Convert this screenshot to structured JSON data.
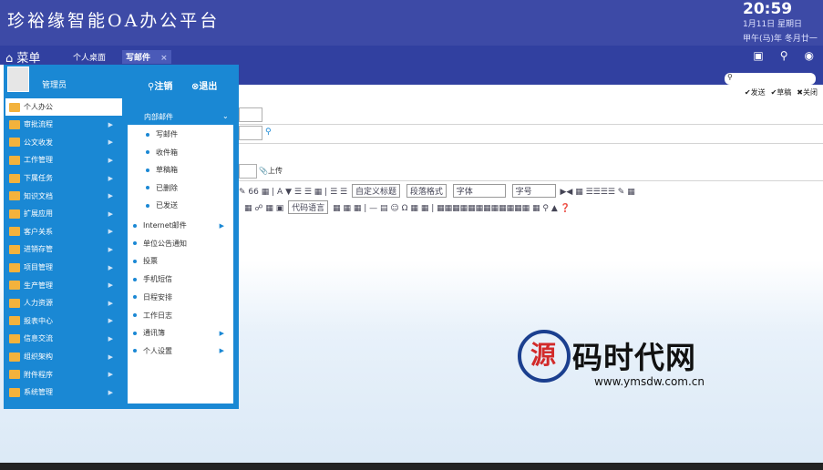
{
  "header": {
    "title": "珍裕缘智能OA办公平台",
    "time": "20:59",
    "date": "1月11日 星期日",
    "lunar": "甲午(马)年 冬月廿一"
  },
  "tabs": {
    "menu": "菜单",
    "home": "个人桌面",
    "compose": "写邮件",
    "close": "×"
  },
  "actions": {
    "send": "发送",
    "draft": "草稿",
    "close": "关闭"
  },
  "user": {
    "name": "管理员",
    "logout": "注销",
    "exit": "退出"
  },
  "nav": [
    {
      "label": "个人办公",
      "active": true
    },
    {
      "label": "审批流程"
    },
    {
      "label": "公文收发"
    },
    {
      "label": "工作管理"
    },
    {
      "label": "下属任务"
    },
    {
      "label": "知识文档"
    },
    {
      "label": "扩展应用"
    },
    {
      "label": "客户关系"
    },
    {
      "label": "进销存管"
    },
    {
      "label": "项目管理"
    },
    {
      "label": "生产管理"
    },
    {
      "label": "人力资源"
    },
    {
      "label": "报表中心"
    },
    {
      "label": "信息交流"
    },
    {
      "label": "组织架构"
    },
    {
      "label": "附件程序"
    },
    {
      "label": "系统管理"
    }
  ],
  "submenu": {
    "header": "内部邮件",
    "mail_items": [
      "写邮件",
      "收件箱",
      "草稿箱",
      "已删除",
      "已发送"
    ],
    "items": [
      {
        "label": "Internet邮件",
        "arrow": true
      },
      {
        "label": "单位公告通知"
      },
      {
        "label": "投票"
      },
      {
        "label": "手机短信"
      },
      {
        "label": "日程安排"
      },
      {
        "label": "工作日志"
      },
      {
        "label": "通讯簿",
        "arrow": true
      },
      {
        "label": "个人设置",
        "arrow": true
      }
    ]
  },
  "editor": {
    "upload": "上传",
    "toolbar1": [
      "66",
      "A",
      "自定义标题",
      "段落格式",
      "字体",
      "字号"
    ],
    "code_lang": "代码语言"
  },
  "watermark": {
    "logo_char": "源",
    "text": "码时代网",
    "url": "www.ymsdw.com.cn"
  },
  "colors": {
    "header_bg": "#3d4aa6",
    "sidebar_bg": "#1a88d4"
  }
}
